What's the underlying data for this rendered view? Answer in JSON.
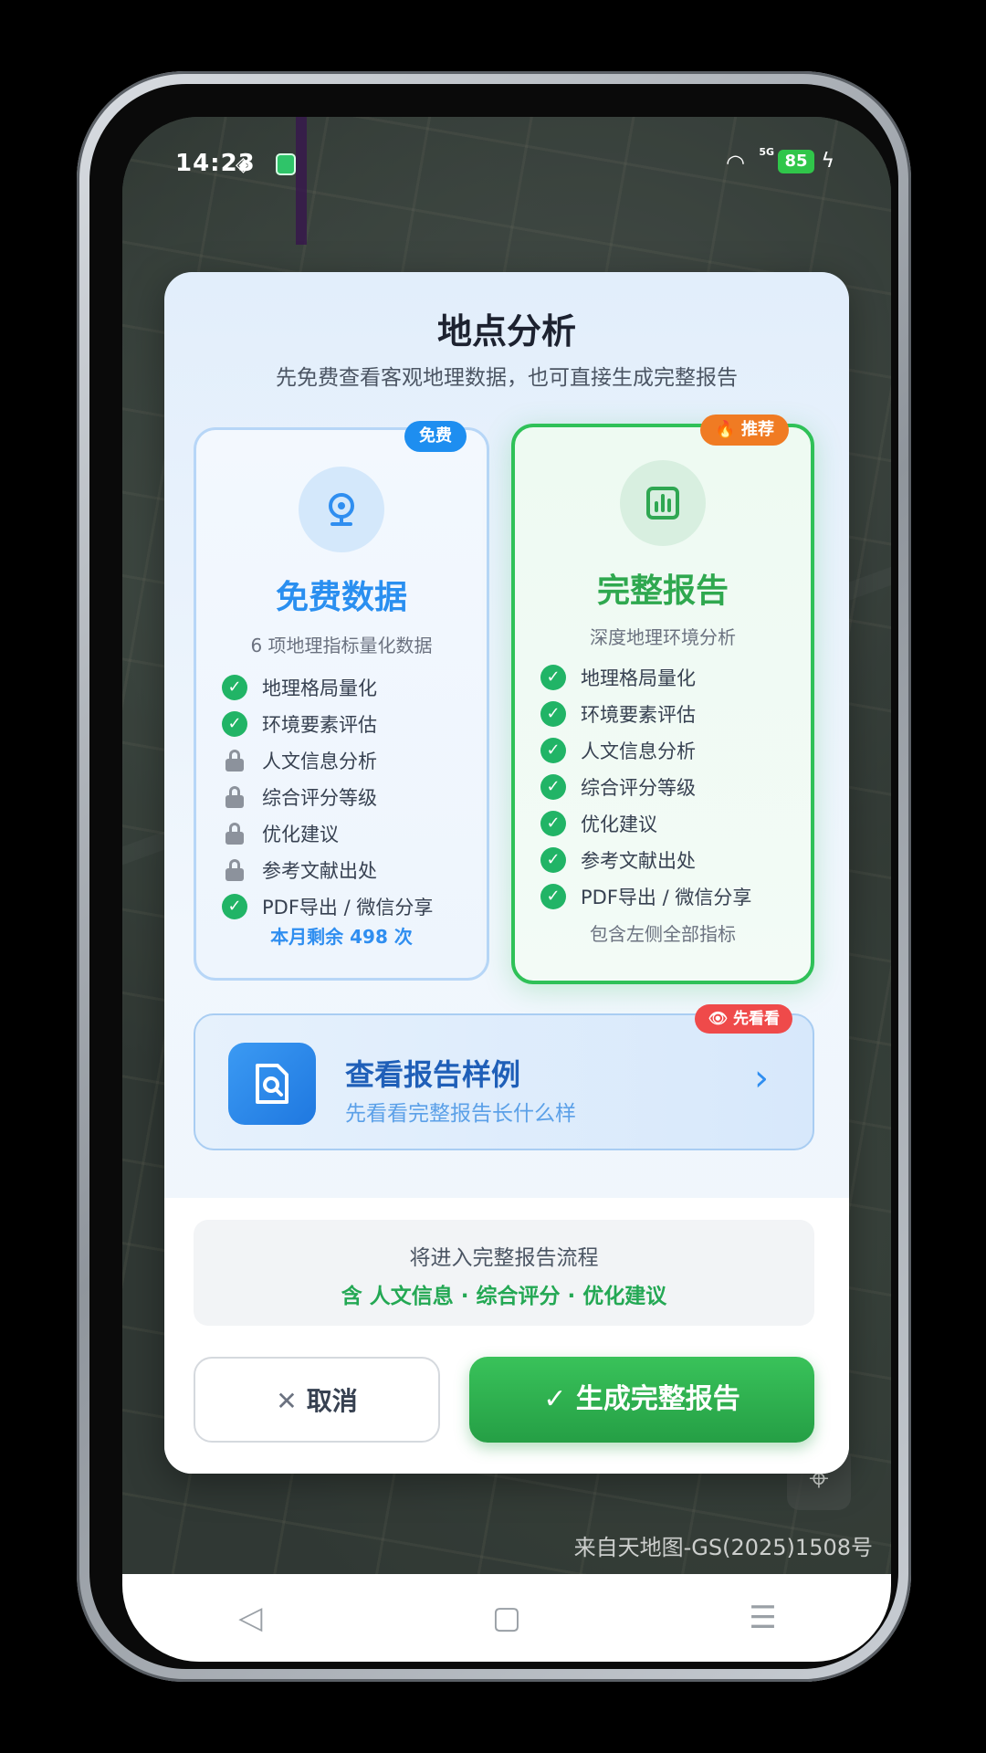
{
  "status_bar": {
    "time": "14:23",
    "battery": "85",
    "signal": "5G"
  },
  "dialog": {
    "title": "地点分析",
    "subtitle": "先免费查看客观地理数据，也可直接生成完整报告"
  },
  "free_card": {
    "badge": "免费",
    "title": "免费数据",
    "desc": "6 项地理指标量化数据",
    "features": [
      {
        "label": "地理格局量化",
        "unlocked": true
      },
      {
        "label": "环境要素评估",
        "unlocked": true
      },
      {
        "label": "人文信息分析",
        "unlocked": false
      },
      {
        "label": "综合评分等级",
        "unlocked": false
      },
      {
        "label": "优化建议",
        "unlocked": false
      },
      {
        "label": "参考文献出处",
        "unlocked": false
      },
      {
        "label": "PDF导出 / 微信分享",
        "unlocked": true
      }
    ],
    "footer": "本月剩余 498 次"
  },
  "full_card": {
    "badge": "🔥 推荐",
    "title": "完整报告",
    "desc": "深度地理环境分析",
    "features": [
      {
        "label": "地理格局量化",
        "unlocked": true
      },
      {
        "label": "环境要素评估",
        "unlocked": true
      },
      {
        "label": "人文信息分析",
        "unlocked": true
      },
      {
        "label": "综合评分等级",
        "unlocked": true
      },
      {
        "label": "优化建议",
        "unlocked": true
      },
      {
        "label": "参考文献出处",
        "unlocked": true
      },
      {
        "label": "PDF导出 / 微信分享",
        "unlocked": true
      }
    ],
    "footer": "包含左侧全部指标"
  },
  "sample": {
    "badge": "先看看",
    "title": "查看报告样例",
    "subtitle": "先看看完整报告长什么样"
  },
  "flow": {
    "line1": "将进入完整报告流程",
    "line2": "含 人文信息 · 综合评分 · 优化建议"
  },
  "buttons": {
    "cancel": "取消",
    "generate": "生成完整报告"
  },
  "map": {
    "attribution": "来自天地图-GS(2025)1508号"
  },
  "icons": {
    "free_card": "location-pin-icon",
    "full_card": "bar-chart-icon",
    "sample": "document-search-icon",
    "check": "check-circle-icon",
    "lock": "lock-icon"
  },
  "colors": {
    "free_accent": "#2a8ff0",
    "full_accent": "#2fa84f",
    "recommend_badge": "#f07b23",
    "sample_badge": "#ef4a4a"
  }
}
